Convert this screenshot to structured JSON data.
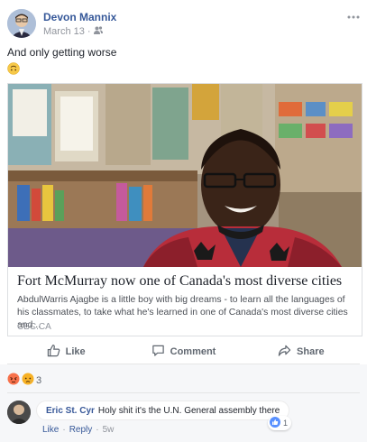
{
  "post": {
    "author": "Devon Mannix",
    "date": "March 13",
    "privacy_icon": "friends-icon",
    "text": "And only getting worse",
    "emoji": "upside-down-face-emoji"
  },
  "link": {
    "title": "Fort McMurray now one of Canada's most diverse cities",
    "description": "AbdulWarris Ajagbe is a little boy with big dreams - to learn all the languages of his classmates, to take what he's learned in one of Canada's most diverse cities and...",
    "source": "CBC.CA"
  },
  "actions": {
    "like": "Like",
    "comment": "Comment",
    "share": "Share"
  },
  "reactions": {
    "count": "3",
    "types": [
      "angry",
      "sad"
    ]
  },
  "comment": {
    "author": "Eric St. Cyr",
    "text": "Holy shit it's the U.N. General assembly there",
    "like_label": "Like",
    "reply_label": "Reply",
    "time": "5w",
    "separator": "·",
    "likes": "1"
  },
  "colors": {
    "link_blue": "#365899",
    "muted": "#90949c",
    "like_blue": "#5890ff",
    "angry": "#f7714b",
    "sad": "#f7b125"
  }
}
